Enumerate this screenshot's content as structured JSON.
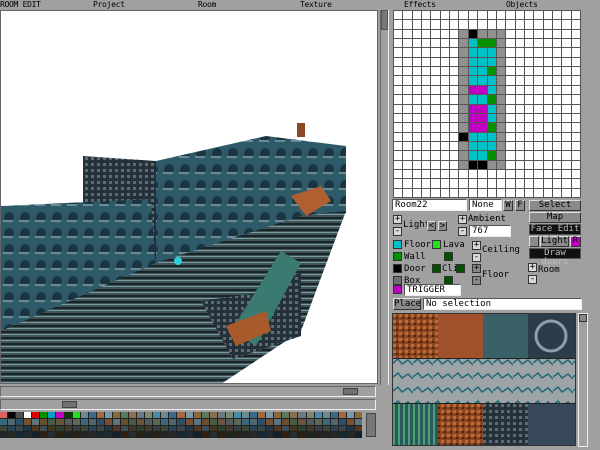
{
  "menu": [
    "ROOM EDIT",
    "Project",
    "Room",
    "Texture",
    "Effects",
    "Objects"
  ],
  "grid_map": {
    "legend": {
      "W": "#ffffff",
      "G": "#909090",
      "K": "#000000",
      "C": "#00c0c8",
      "N": "#009000",
      "M": "#c000c0"
    },
    "origin_col": 7,
    "origin_row": 2,
    "rows": [
      "GKGGG",
      "GCNNG",
      "GCCCG",
      "GCCCG",
      "GCCNG",
      "GCCCG",
      "GMMCG",
      "GCCNG",
      "GMMCG",
      "GMMCG",
      "GMMNG",
      "KCCCG",
      "GCCCG",
      "GCCNG",
      "GKKGG"
    ]
  },
  "room": {
    "name": "Room22",
    "flip": "None",
    "w_label": "W",
    "f_label": "F"
  },
  "buttons": {
    "select": "Select",
    "map": "Map",
    "face_edit": "Face Edit",
    "light": "Light",
    "r": "R",
    "draw_doors": "Draw doors",
    "place": "Place"
  },
  "light": {
    "label": "Light",
    "prev": "<",
    "next": ">",
    "plus": "+",
    "minus": "-"
  },
  "ambient": {
    "label": "Ambient",
    "value": "767"
  },
  "types": {
    "floor": "Floor",
    "lava": "Lava",
    "wall": "Wall",
    "door": "Door",
    "box": "Box",
    "cli": "Cli",
    "trigger": "TRIGGER"
  },
  "ceiling": {
    "label": "Ceiling"
  },
  "floor_ctl": {
    "label": "Floor"
  },
  "room_ctl": {
    "label": "Room"
  },
  "selection": "No selection",
  "colors": {
    "floor": "#00c0c8",
    "lava": "#20e020",
    "wall": "#009000",
    "door": "#000000",
    "box": "#707070",
    "trigger": "#c000c0",
    "cli": "#005000"
  },
  "palette_first": [
    "#e06060",
    "#000000",
    "#505050",
    "#ffffff",
    "#e00000",
    "#009000",
    "#00a0c0",
    "#c000c0",
    "#004000",
    "#20e020"
  ]
}
